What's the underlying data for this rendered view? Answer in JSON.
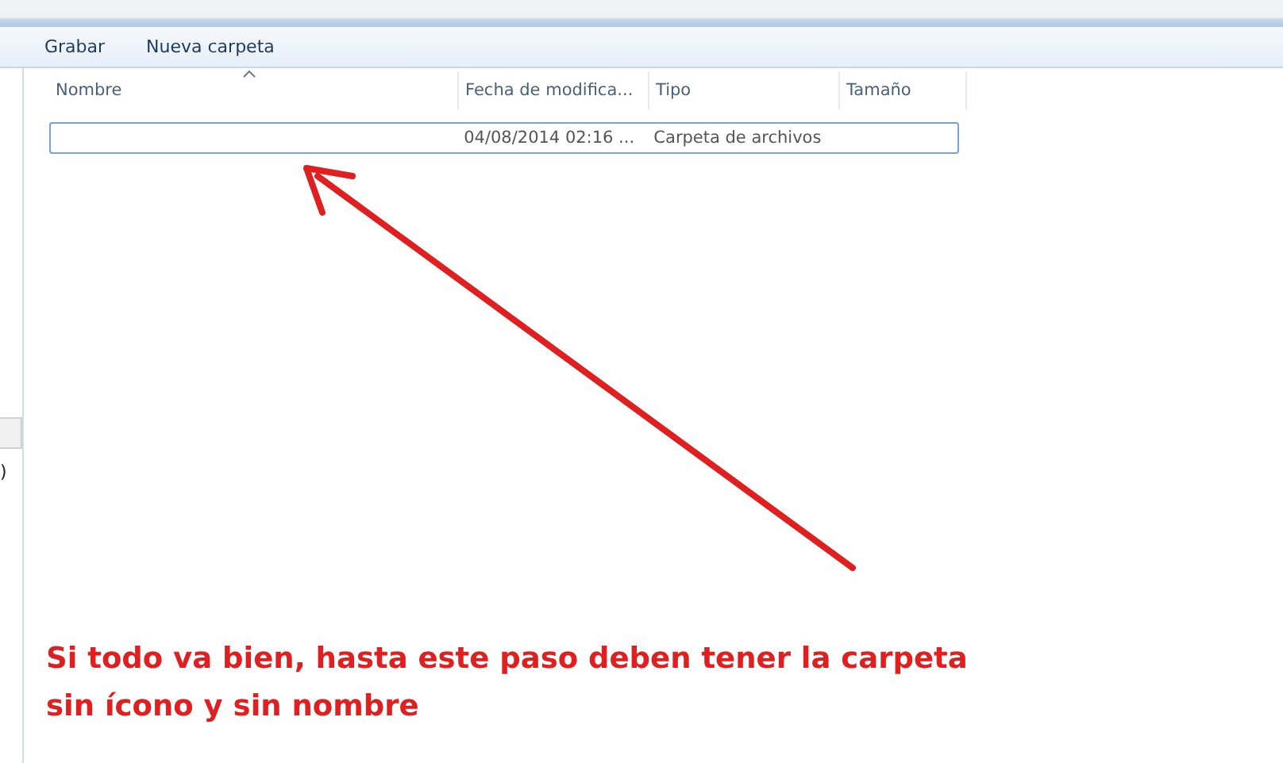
{
  "toolbar": {
    "buttons": [
      "Grabar",
      "Nueva carpeta"
    ]
  },
  "left_pane": {
    "fragment": ")"
  },
  "table": {
    "columns": [
      "Nombre",
      "Fecha de modifica...",
      "Tipo",
      "Tamaño"
    ],
    "rows": [
      {
        "name": "",
        "date": "04/08/2014 02:16 ...",
        "type": "Carpeta de archivos",
        "size": "",
        "selected": true
      }
    ]
  },
  "annotation": {
    "lines": [
      "Si todo va bien, hasta este paso deben tener la carpeta",
      "sin ícono y sin nombre"
    ]
  }
}
